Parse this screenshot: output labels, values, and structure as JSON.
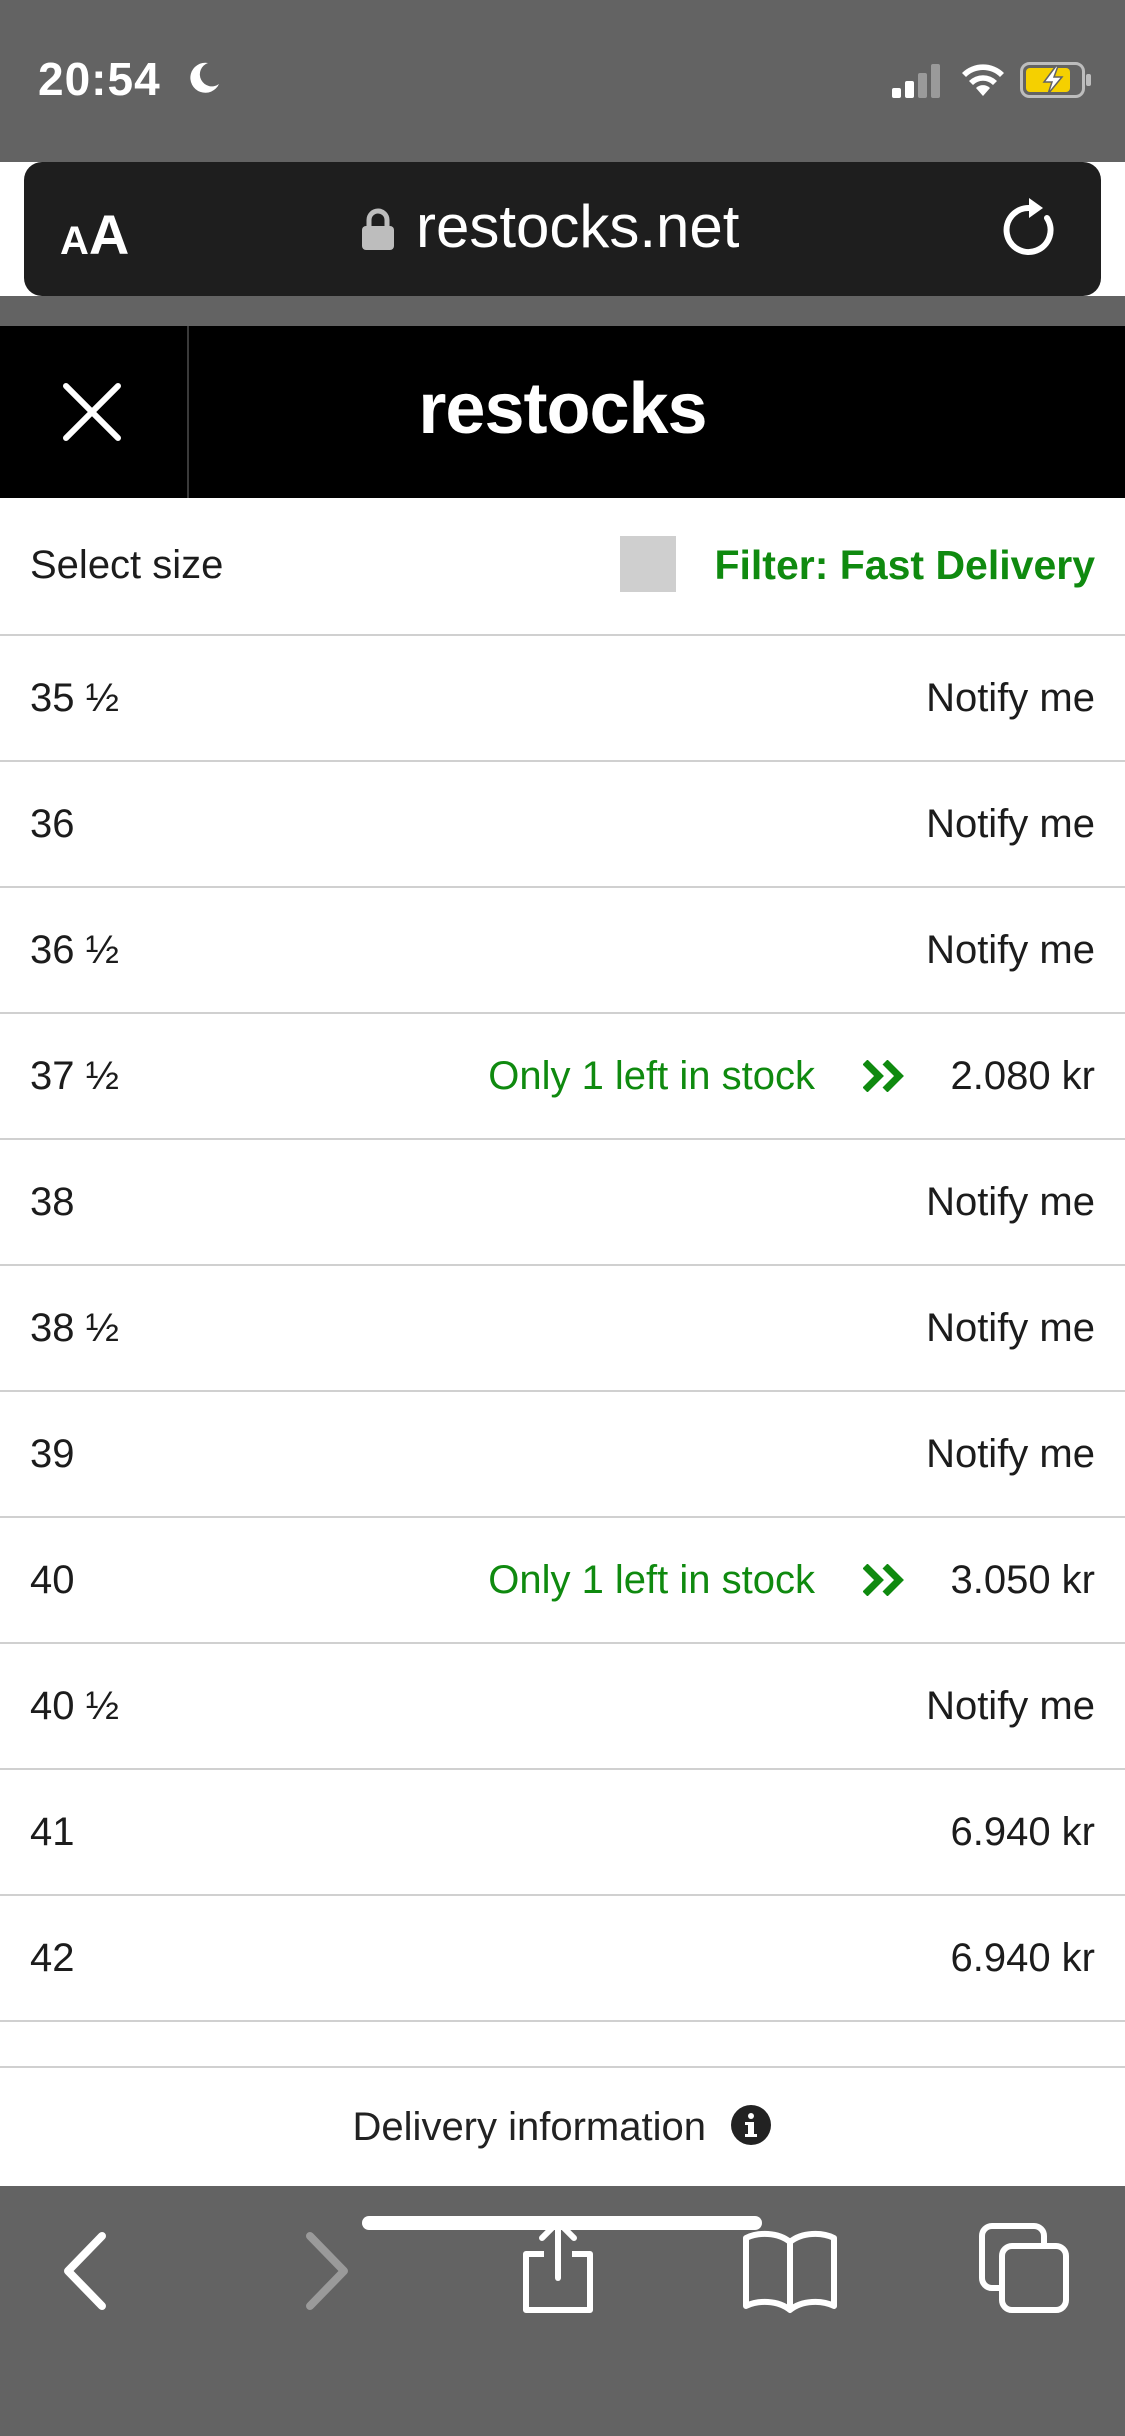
{
  "status_bar": {
    "time": "20:54",
    "moon_icon": "moon-icon",
    "signal_icon": "cellular-signal-icon",
    "wifi_icon": "wifi-icon",
    "battery_icon": "battery-charging-icon",
    "battery_color": "#f5d000"
  },
  "address_bar": {
    "text_size_small": "A",
    "text_size_big": "A",
    "url": "restocks.net",
    "lock_icon": "lock-icon",
    "reload_icon": "reload-icon"
  },
  "site_header": {
    "close_icon": "close-icon",
    "logo": "restocks"
  },
  "filter": {
    "select_size_label": "Select size",
    "fast_delivery_label": "Filter: Fast Delivery",
    "fast_delivery_checked": false,
    "accent_color": "#0f8a0f"
  },
  "sizes": [
    {
      "size": "35 ½",
      "status": "",
      "action": "Notify me"
    },
    {
      "size": "36",
      "status": "",
      "action": "Notify me"
    },
    {
      "size": "36 ½",
      "status": "",
      "action": "Notify me"
    },
    {
      "size": "37 ½",
      "status": "Only 1 left in stock",
      "fast_icon": "fast-delivery-chevrons-icon",
      "action": "2.080 kr"
    },
    {
      "size": "38",
      "status": "",
      "action": "Notify me"
    },
    {
      "size": "38 ½",
      "status": "",
      "action": "Notify me"
    },
    {
      "size": "39",
      "status": "",
      "action": "Notify me"
    },
    {
      "size": "40",
      "status": "Only 1 left in stock",
      "fast_icon": "fast-delivery-chevrons-icon",
      "action": "3.050 kr"
    },
    {
      "size": "40 ½",
      "status": "",
      "action": "Notify me"
    },
    {
      "size": "41",
      "status": "",
      "action": "6.940 kr"
    },
    {
      "size": "42",
      "status": "",
      "action": "6.940 kr"
    }
  ],
  "delivery": {
    "label": "Delivery information",
    "info_icon": "info-icon"
  },
  "toolbar": {
    "back_icon": "back-chevron-icon",
    "forward_icon": "forward-chevron-icon",
    "share_icon": "share-icon",
    "bookmarks_icon": "book-icon",
    "tabs_icon": "tabs-icon"
  }
}
